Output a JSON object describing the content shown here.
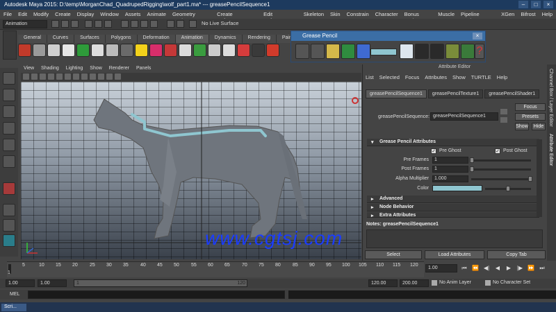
{
  "window": {
    "title": "Autodesk Maya 2015: D:\\temp\\MorganChad_QuadrupedRigging\\wolf_part1.ma*   ---   greasePencilSequence1",
    "controls": [
      "–",
      "□",
      "×"
    ]
  },
  "menubar": [
    "File",
    "Edit",
    "Modify",
    "Create",
    "Display",
    "Window",
    "Assets",
    "Animate",
    "Geometry Cache",
    "Create Deformers",
    "Edit Deformers",
    "Skeleton",
    "Skin",
    "Constrain",
    "Character",
    "Bonus Tools",
    "Muscle",
    "Pipeline Cache",
    "XGen",
    "Bifrost",
    "Help"
  ],
  "statusline": {
    "mode": "Animation",
    "live_surface": "No Live Surface"
  },
  "shelf": {
    "tabs": [
      "General",
      "Curves",
      "Surfaces",
      "Polygons",
      "Deformation",
      "Animation",
      "Dynamics",
      "Rendering",
      "PaintEffects"
    ],
    "active_tab": "Animation"
  },
  "viewport": {
    "menu": [
      "View",
      "Shading",
      "Lighting",
      "Show",
      "Renderer",
      "Panels"
    ],
    "watermark": "www.cgtsj.com"
  },
  "grease_pencil": {
    "title": "Grease Pencil",
    "close": "×",
    "color": "#8fc6d0"
  },
  "attribute_editor": {
    "title": "Attribute Editor",
    "menu": [
      "List",
      "Selected",
      "Focus",
      "Attributes",
      "Show",
      "TURTLE",
      "Help"
    ],
    "tabs": [
      "greasePencilSequence1",
      "greasePencilTexture1",
      "greasePencilShader1"
    ],
    "node_label": "greasePencilSequence:",
    "node_value": "greasePencilSequence1",
    "buttons": {
      "focus": "Focus",
      "presets": "Presets",
      "show": "Show",
      "hide": "Hide"
    },
    "sections": {
      "gp_attributes": "Grease Pencil Attributes",
      "advanced": "Advanced",
      "node_behavior": "Node Behavior",
      "extra": "Extra Attributes"
    },
    "pre_ghost": "Pre Ghost",
    "post_ghost": "Post Ghost",
    "pre_frames_label": "Pre Frames",
    "pre_frames_value": "1",
    "post_frames_label": "Post Frames",
    "post_frames_value": "1",
    "alpha_label": "Alpha Multiplier",
    "alpha_value": "1.000",
    "color_label": "Color",
    "color_value": "#8fc6d0",
    "notes_label": "Notes: greasePencilSequence1",
    "bottom_buttons": [
      "Select",
      "Load Attributes",
      "Copy Tab"
    ]
  },
  "right_tabs": [
    "Channel Box / Layer Editor",
    "Attribute Editor"
  ],
  "timeline": {
    "ticks": [
      "5",
      "10",
      "15",
      "20",
      "25",
      "30",
      "35",
      "40",
      "45",
      "50",
      "55",
      "60",
      "65",
      "70",
      "75",
      "80",
      "85",
      "90",
      "95",
      "100",
      "105",
      "110",
      "115",
      "120"
    ],
    "current": "1",
    "time_field": "1.00",
    "playback": [
      "⏮",
      "⏪",
      "◀|",
      "◀",
      "▶",
      "|▶",
      "⏩",
      "⏭"
    ]
  },
  "range": {
    "start": "1.00",
    "start2": "1.00",
    "range_start_label": "1",
    "range_end_label": "120",
    "end": "120.00",
    "end2": "200.00",
    "anim_layer": "No Anim Layer",
    "character_set": "No Character Set"
  },
  "command_line": {
    "label": "MEL"
  },
  "taskbar": {
    "item": "Scri..."
  }
}
